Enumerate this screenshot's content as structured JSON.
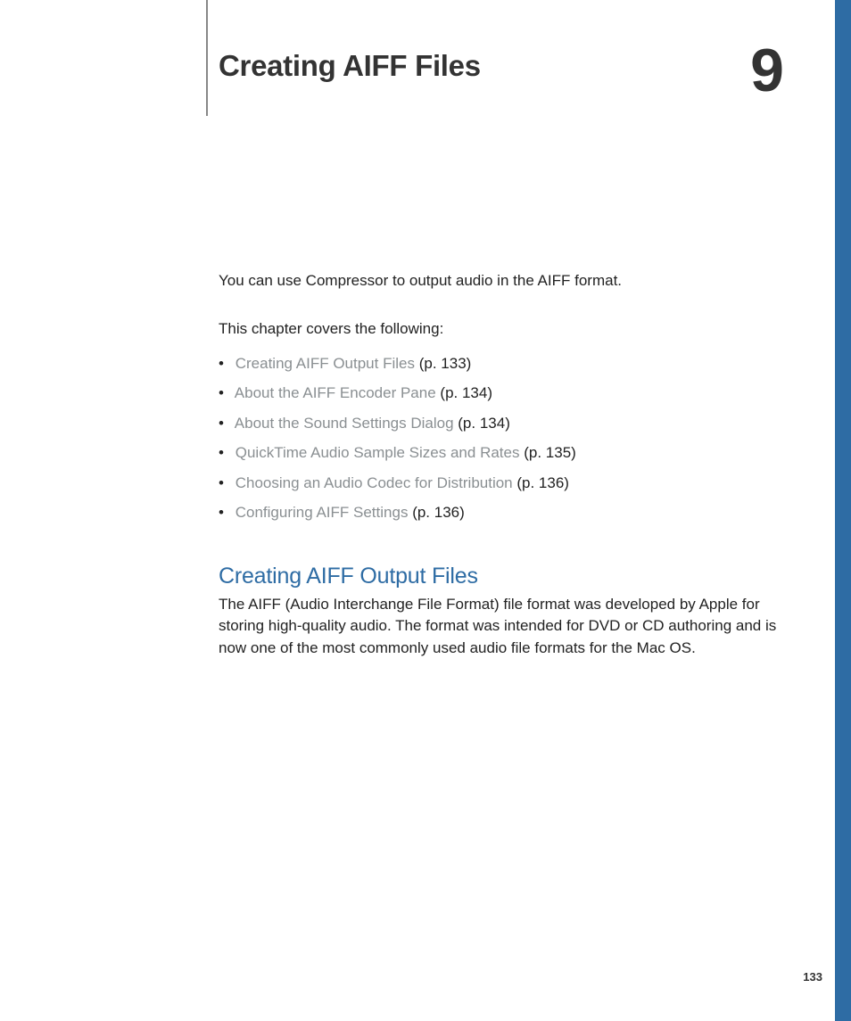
{
  "chapter": {
    "title": "Creating AIFF Files",
    "number": "9"
  },
  "intro": "You can use Compressor to output audio in the AIFF format.",
  "covers_label": "This chapter covers the following:",
  "toc": [
    {
      "label": "Creating AIFF Output Files",
      "page": "(p. 133)"
    },
    {
      "label": "About the AIFF Encoder Pane",
      "page": "(p. 134)"
    },
    {
      "label": "About the Sound Settings Dialog",
      "page": "(p. 134)"
    },
    {
      "label": "QuickTime Audio Sample Sizes and Rates",
      "page": "(p. 135)"
    },
    {
      "label": "Choosing an Audio Codec for Distribution",
      "page": "(p. 136)"
    },
    {
      "label": "Configuring AIFF Settings",
      "page": "(p. 136)"
    }
  ],
  "section": {
    "heading": "Creating AIFF Output Files",
    "body": "The AIFF (Audio Interchange File Format) file format was developed by Apple for storing high-quality audio. The format was intended for DVD or CD authoring and is now one of the most commonly used audio file formats for the Mac OS."
  },
  "page_number": "133",
  "colors": {
    "accent": "#2e6ca4",
    "link_gray": "#8a8f92"
  }
}
